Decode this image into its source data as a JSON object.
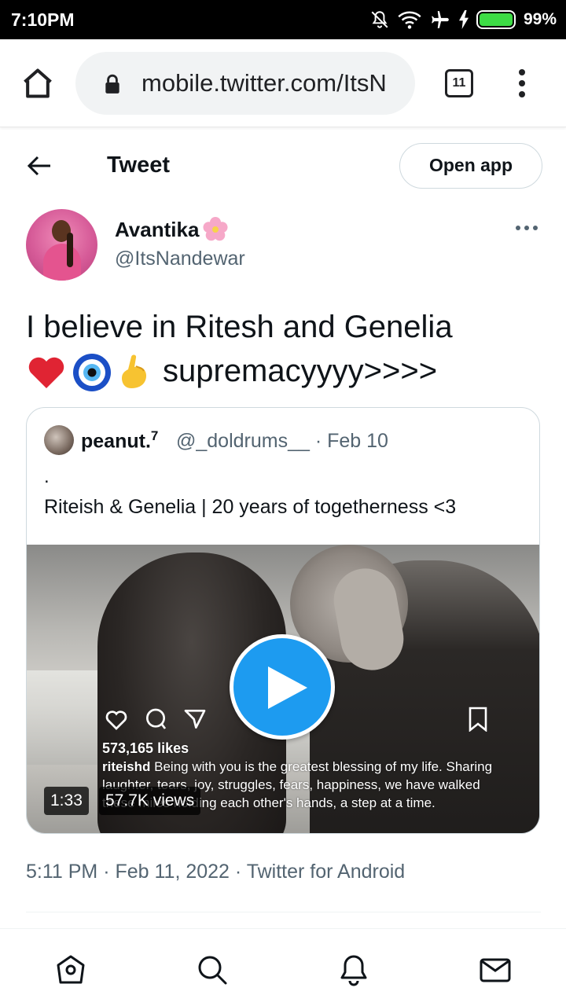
{
  "statusbar": {
    "time": "7:10PM",
    "battery_pct": "99%",
    "battery_level": 0.99,
    "icons": [
      "notifications-off-icon",
      "wifi-icon",
      "airplane-icon",
      "charging-icon",
      "battery-icon"
    ]
  },
  "browser": {
    "url": "mobile.twitter.com/ItsN",
    "tab_count": "11"
  },
  "header": {
    "title": "Tweet",
    "open_app_label": "Open app"
  },
  "author": {
    "name": "Avantika",
    "name_emoji": "cherry-blossom",
    "handle": "@ItsNandewar"
  },
  "tweet": {
    "text_line1": "I believe in Ritesh and Genelia",
    "text_tail": "supremacyyyy>>>>",
    "emojis": [
      "red-heart",
      "nazar-amulet",
      "pinching-hand"
    ]
  },
  "quote": {
    "name": "peanut.",
    "name_sup": "7",
    "handle_date": "@_doldrums__ · Feb 10",
    "dot": ".",
    "text": "Riteish & Genelia | 20 years of togetherness <3",
    "media": {
      "likes": "573,165 likes",
      "caption_user": "riteishd",
      "caption": "Being with you is the greatest blessing of my life. Sharing laughter, tears, joy, struggles, fears, happiness, we have walked these miles holding each other's hands, a step at a time.",
      "duration": "1:33",
      "views": "57.7K views"
    }
  },
  "meta": {
    "text": "5:11 PM · Feb 11, 2022 · Twitter for Android"
  },
  "nav": [
    "home-icon",
    "search-icon",
    "notifications-icon",
    "messages-icon"
  ],
  "colors": {
    "accent": "#1d9bf0",
    "text": "#0f1419",
    "secondary": "#536471",
    "border": "#cfd9de"
  }
}
